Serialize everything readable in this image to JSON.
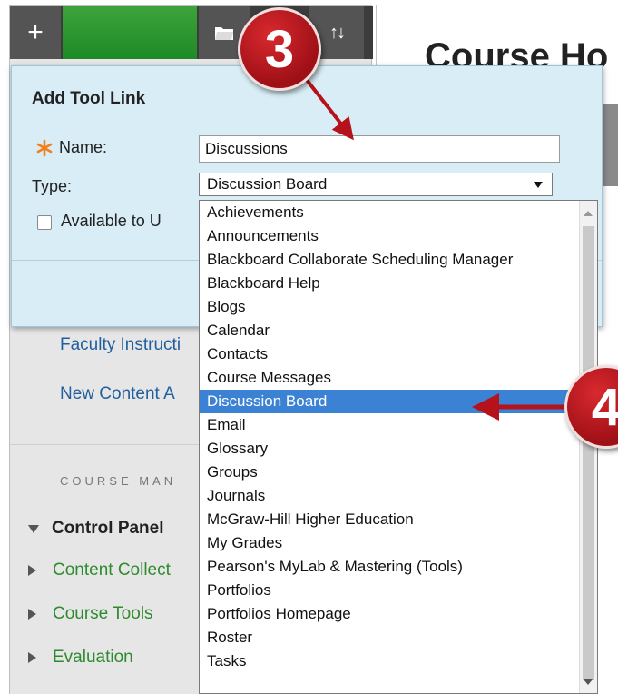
{
  "menu_toolbar": {
    "add_icon": "plus-icon",
    "folder_icon": "folder-icon",
    "sort_icon": "sort-icon",
    "add_glyph": "+",
    "sort_glyph": "↑↓"
  },
  "course_menu": {
    "links": [
      {
        "label": "Faculty Instructi"
      },
      {
        "label": "New Content A"
      }
    ],
    "management_heading": "COURSE MAN",
    "control_panel_label": "Control Panel",
    "control_panel_items": [
      {
        "label": "Content Collect"
      },
      {
        "label": "Course Tools"
      },
      {
        "label": "Evaluation"
      }
    ]
  },
  "main": {
    "title": "Course Ho"
  },
  "popup": {
    "title": "Add Tool Link",
    "name_label": "Name:",
    "name_value": "Discussions",
    "type_label": "Type:",
    "type_value": "Discussion Board",
    "available_label": "Available to U",
    "available_checked": false
  },
  "dropdown": {
    "selected_index": 8,
    "options": [
      "Achievements",
      "Announcements",
      "Blackboard Collaborate Scheduling Manager",
      "Blackboard Help",
      "Blogs",
      "Calendar",
      "Contacts",
      "Course Messages",
      "Discussion Board",
      "Email",
      "Glossary",
      "Groups",
      "Journals",
      "McGraw-Hill Higher Education",
      "My Grades",
      "Pearson's MyLab & Mastering (Tools)",
      "Portfolios",
      "Portfolios Homepage",
      "Roster",
      "Tasks"
    ]
  },
  "callouts": {
    "step_3": "3",
    "step_4": "4"
  },
  "colors": {
    "popup_background": "#d8edf5",
    "selected_option": "#3c82d4",
    "callout_red": "#b5121b",
    "menu_green": "#2e8b2e",
    "link_blue": "#1f5f9e",
    "required_star": "#f07f1e"
  }
}
